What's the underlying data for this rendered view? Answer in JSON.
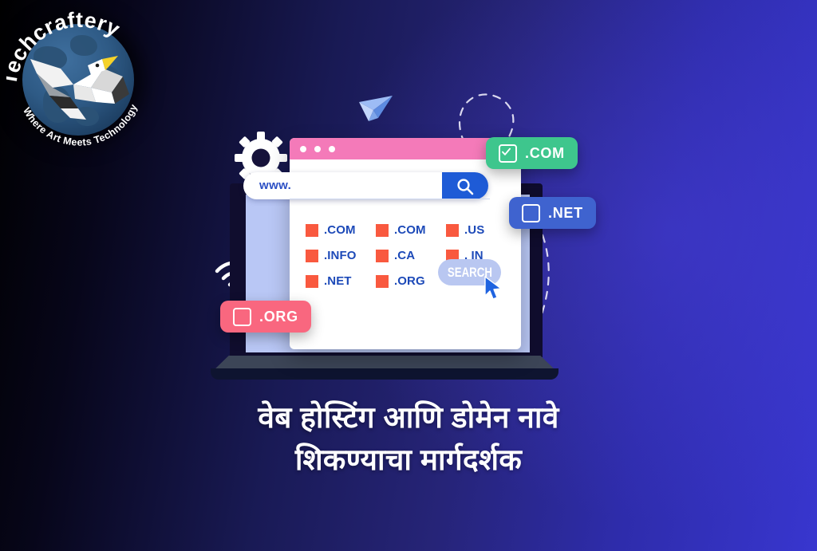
{
  "background": {
    "gradient_from": "#000000",
    "gradient_to": "#3836cf"
  },
  "logo": {
    "name": "logo",
    "brand": "Techcraftery",
    "tagline": "Where Art Meets Technology",
    "mark": "albatross-over-globe"
  },
  "laptop": {
    "name": "laptop-mockup",
    "bezel_color": "#100d2e",
    "screen_color": "#b9c7f5",
    "base_color": "#3c4557"
  },
  "browser": {
    "titlebar_color": "#f47ab9",
    "dots": [
      "dot-1",
      "dot-2",
      "dot-3"
    ],
    "search": {
      "value": "www.",
      "placeholder": "www.",
      "button_icon": "search-icon",
      "button_color": "#1e5bd6"
    },
    "tlds": [
      {
        "label": ".COM",
        "swatch": "#f9593f"
      },
      {
        "label": ".COM",
        "swatch": "#f9593f"
      },
      {
        "label": ".US",
        "swatch": "#f9593f"
      },
      {
        "label": ".INFO",
        "swatch": "#f9593f"
      },
      {
        "label": ".CA",
        "swatch": "#f9593f"
      },
      {
        "label": ". IN",
        "swatch": "#f9593f"
      },
      {
        "label": ".NET",
        "swatch": "#f9593f"
      },
      {
        "label": ".ORG",
        "swatch": "#f9593f"
      }
    ],
    "search_button": {
      "label": "SEARCH",
      "color": "#b9c7f1"
    }
  },
  "badges": [
    {
      "label": ".COM",
      "checked": true,
      "color": "#3ec68d"
    },
    {
      "label": ".NET",
      "checked": false,
      "color": "#3f63cf"
    },
    {
      "label": ".ORG",
      "checked": false,
      "color": "#f9677f"
    }
  ],
  "decor": {
    "gear": "gear-icon",
    "wifi": "wifi-icon",
    "plane": "paper-plane-icon",
    "cursor": "mouse-cursor-icon"
  },
  "headline": {
    "line1": "वेब होस्टिंग आणि डोमेन नावे",
    "line2": "शिकण्याचा मार्गदर्शक"
  }
}
